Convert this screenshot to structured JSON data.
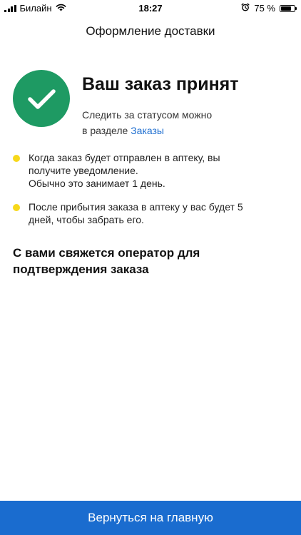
{
  "status_bar": {
    "carrier": "Билайн",
    "time": "18:27",
    "battery_percent": "75 %",
    "battery_level": 0.75,
    "icons": [
      "signal-icon",
      "wifi-icon",
      "alarm-icon",
      "battery-icon"
    ]
  },
  "header": {
    "title": "Оформление доставки"
  },
  "success": {
    "icon": "checkmark-icon",
    "icon_color": "#1e9a63",
    "title": "Ваш заказ принят",
    "text_line1": "Следить за статусом можно",
    "text_line2_prefix": "в разделе ",
    "orders_link": "Заказы",
    "link_color": "#1f6fd0"
  },
  "info": {
    "bullet_color": "#f7d81a",
    "items": [
      {
        "line1": "Когда заказ будет отправлен в аптеку, вы",
        "line2": "получите уведомление.",
        "line3": "Обычно это занимает 1 день."
      },
      {
        "line1": "После прибытия заказа в аптеку у вас будет 5",
        "line2": "дней, чтобы забрать его."
      }
    ]
  },
  "operator_note": {
    "line1": "С вами свяжется оператор для",
    "line2": "подтверждения заказа"
  },
  "footer": {
    "button_label": "Вернуться на главную",
    "button_color": "#1a6ccf"
  }
}
